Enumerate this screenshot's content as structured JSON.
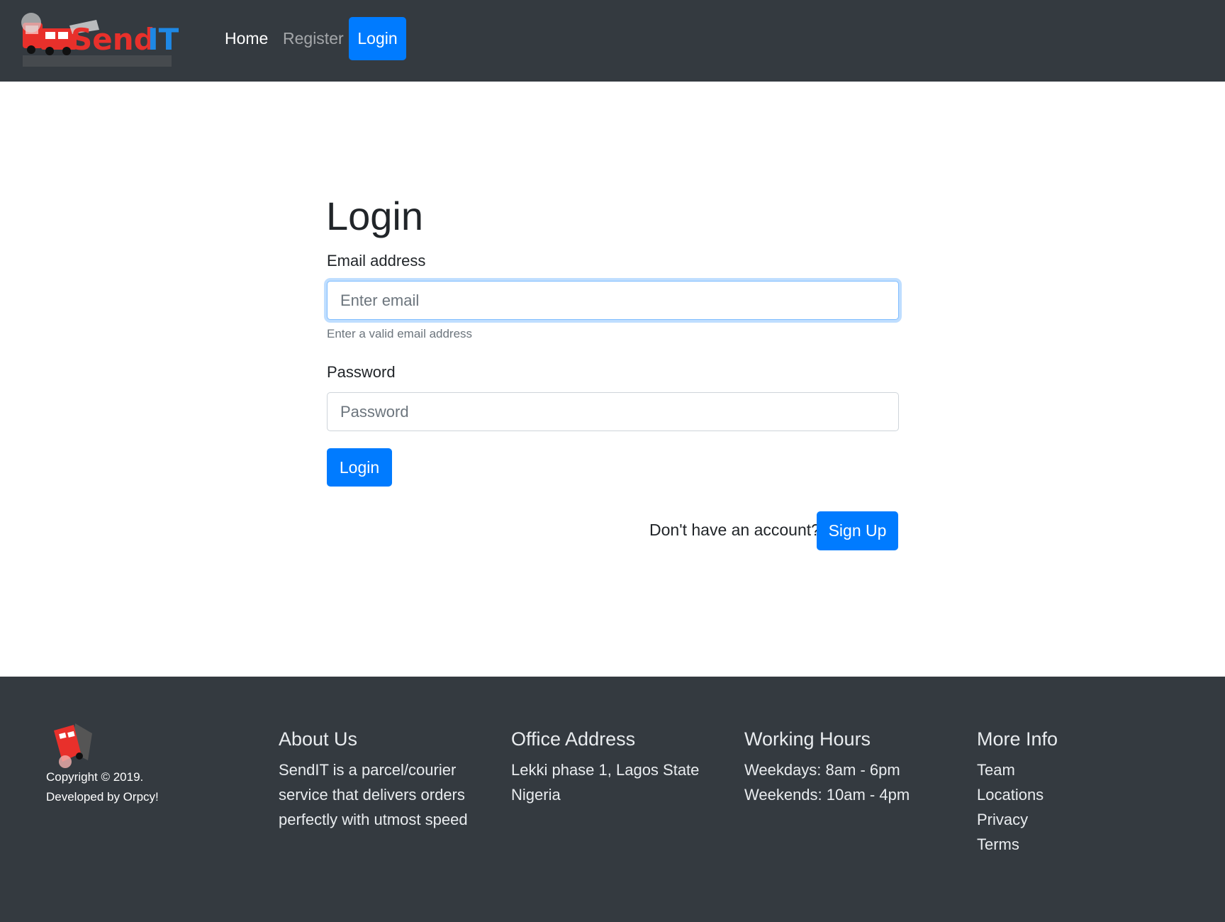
{
  "navbar": {
    "brand_text": "SendIT",
    "links": {
      "home": "Home",
      "register": "Register",
      "login": "Login"
    }
  },
  "login_form": {
    "title": "Login",
    "email_label": "Email address",
    "email_placeholder": "Enter email",
    "email_help": "Enter a valid email address",
    "password_label": "Password",
    "password_placeholder": "Password",
    "submit_label": "Login",
    "signup_prompt": "Don't have an account?",
    "signup_label": "Sign Up"
  },
  "footer": {
    "copyright_line1": "Copyright © 2019.",
    "copyright_line2": "Developed by Orpcy!",
    "about": {
      "heading": "About Us",
      "lines": [
        "SendIT is a parcel/courier",
        "service that delivers orders",
        "perfectly with utmost speed"
      ]
    },
    "office": {
      "heading": "Office Address",
      "lines": [
        "Lekki phase 1, Lagos State",
        "Nigeria"
      ]
    },
    "hours": {
      "heading": "Working Hours",
      "lines": [
        "Weekdays: 8am - 6pm",
        "Weekends: 10am - 4pm"
      ]
    },
    "more": {
      "heading": "More Info",
      "links": [
        "Team",
        "Locations",
        "Privacy",
        "Terms"
      ]
    }
  },
  "colors": {
    "navbar_bg": "#343a40",
    "primary": "#007bff",
    "brand_red": "#e8302b",
    "brand_blue": "#1e88e5"
  },
  "icons": {
    "brand_logo": "delivery-truck-logo",
    "footer_logo": "delivery-truck-icon"
  }
}
